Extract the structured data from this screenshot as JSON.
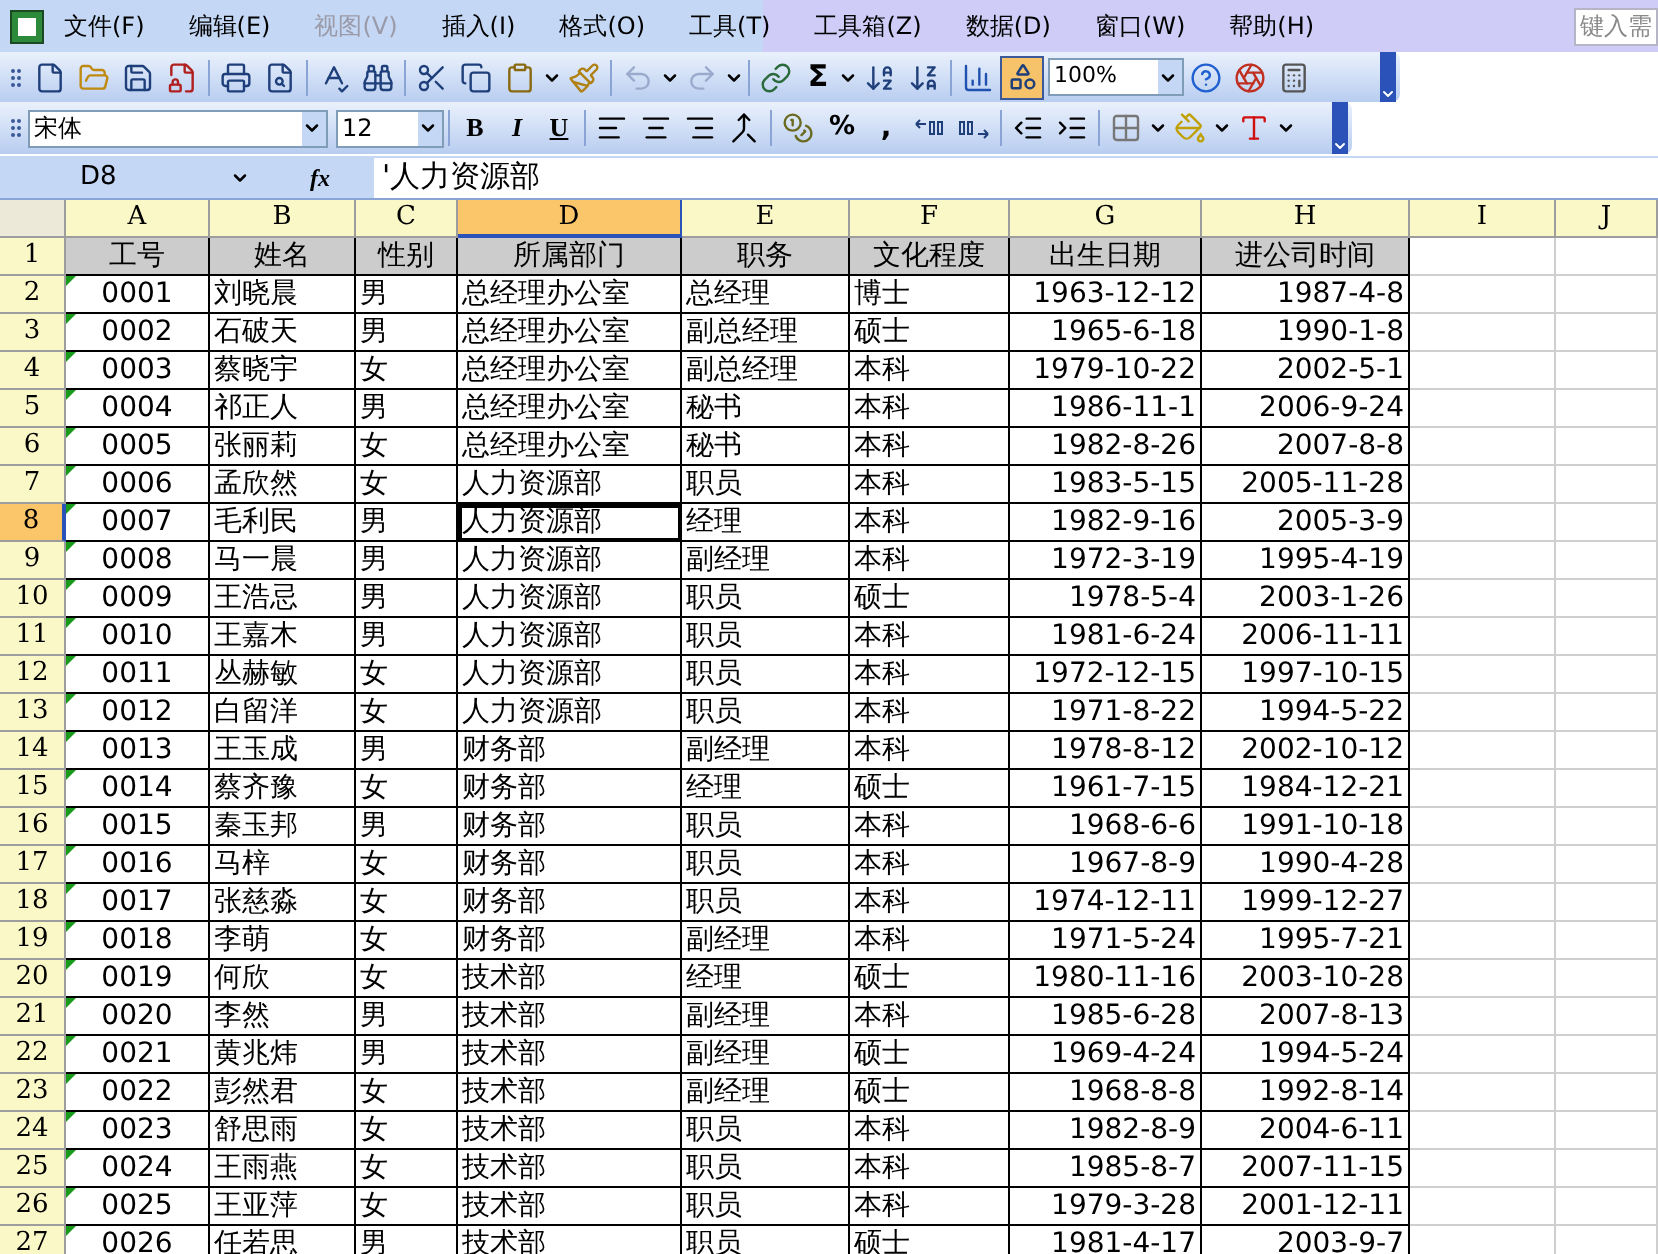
{
  "menu_bar": {
    "items": [
      {
        "label": "文件(F)",
        "disabled": false
      },
      {
        "label": "编辑(E)",
        "disabled": false
      },
      {
        "label": "视图(V)",
        "disabled": true
      },
      {
        "label": "插入(I)",
        "disabled": false
      },
      {
        "label": "格式(O)",
        "disabled": false
      },
      {
        "label": "工具(T)",
        "disabled": false
      },
      {
        "label": "工具箱(Z)",
        "disabled": false
      },
      {
        "label": "数据(D)",
        "disabled": false
      },
      {
        "label": "窗口(W)",
        "disabled": false
      },
      {
        "label": "帮助(H)",
        "disabled": false
      }
    ],
    "help_box": {
      "placeholder": "键入需"
    }
  },
  "standard_toolbar": {
    "sum_symbol": "Σ",
    "zoom": "100%"
  },
  "formatting_toolbar": {
    "font": "宋体",
    "font_size": "12",
    "style_buttons": [
      "B",
      "I",
      "U"
    ],
    "percent": "%",
    "comma": ","
  },
  "formula_bar": {
    "name_box": "D8",
    "fx": "fx",
    "value": "'人力资源部"
  },
  "sheet": {
    "columns": [
      {
        "label": "A",
        "selected": false
      },
      {
        "label": "B",
        "selected": false
      },
      {
        "label": "C",
        "selected": false
      },
      {
        "label": "D",
        "selected": true
      },
      {
        "label": "E",
        "selected": false
      },
      {
        "label": "F",
        "selected": false
      },
      {
        "label": "G",
        "selected": false
      },
      {
        "label": "H",
        "selected": false
      },
      {
        "label": "I",
        "selected": false
      },
      {
        "label": "J",
        "selected": false
      }
    ],
    "rows": [
      {
        "number": "1",
        "selected": false,
        "cells": [
          "工号",
          "姓名",
          "性别",
          "所属部门",
          "职务",
          "文化程度",
          "出生日期",
          "进公司时间"
        ]
      },
      {
        "number": "2",
        "selected": false,
        "cells": [
          "0001",
          "刘晓晨",
          "男",
          "总经理办公室",
          "总经理",
          "博士",
          "1963-12-12",
          "1987-4-8"
        ]
      },
      {
        "number": "3",
        "selected": false,
        "cells": [
          "0002",
          "石破天",
          "男",
          "总经理办公室",
          "副总经理",
          "硕士",
          "1965-6-18",
          "1990-1-8"
        ]
      },
      {
        "number": "4",
        "selected": false,
        "cells": [
          "0003",
          "蔡晓宇",
          "女",
          "总经理办公室",
          "副总经理",
          "本科",
          "1979-10-22",
          "2002-5-1"
        ]
      },
      {
        "number": "5",
        "selected": false,
        "cells": [
          "0004",
          "祁正人",
          "男",
          "总经理办公室",
          "秘书",
          "本科",
          "1986-11-1",
          "2006-9-24"
        ]
      },
      {
        "number": "6",
        "selected": false,
        "cells": [
          "0005",
          "张丽莉",
          "女",
          "总经理办公室",
          "秘书",
          "本科",
          "1982-8-26",
          "2007-8-8"
        ]
      },
      {
        "number": "7",
        "selected": false,
        "cells": [
          "0006",
          "孟欣然",
          "女",
          "人力资源部",
          "职员",
          "本科",
          "1983-5-15",
          "2005-11-28"
        ]
      },
      {
        "number": "8",
        "selected": true,
        "cells": [
          "0007",
          "毛利民",
          "男",
          "人力资源部",
          "经理",
          "本科",
          "1982-9-16",
          "2005-3-9"
        ]
      },
      {
        "number": "9",
        "selected": false,
        "cells": [
          "0008",
          "马一晨",
          "男",
          "人力资源部",
          "副经理",
          "本科",
          "1972-3-19",
          "1995-4-19"
        ]
      },
      {
        "number": "10",
        "selected": false,
        "cells": [
          "0009",
          "王浩忌",
          "男",
          "人力资源部",
          "职员",
          "硕士",
          "1978-5-4",
          "2003-1-26"
        ]
      },
      {
        "number": "11",
        "selected": false,
        "cells": [
          "0010",
          "王嘉木",
          "男",
          "人力资源部",
          "职员",
          "本科",
          "1981-6-24",
          "2006-11-11"
        ]
      },
      {
        "number": "12",
        "selected": false,
        "cells": [
          "0011",
          "丛赫敏",
          "女",
          "人力资源部",
          "职员",
          "本科",
          "1972-12-15",
          "1997-10-15"
        ]
      },
      {
        "number": "13",
        "selected": false,
        "cells": [
          "0012",
          "白留洋",
          "女",
          "人力资源部",
          "职员",
          "本科",
          "1971-8-22",
          "1994-5-22"
        ]
      },
      {
        "number": "14",
        "selected": false,
        "cells": [
          "0013",
          "王玉成",
          "男",
          "财务部",
          "副经理",
          "本科",
          "1978-8-12",
          "2002-10-12"
        ]
      },
      {
        "number": "15",
        "selected": false,
        "cells": [
          "0014",
          "蔡齐豫",
          "女",
          "财务部",
          "经理",
          "硕士",
          "1961-7-15",
          "1984-12-21"
        ]
      },
      {
        "number": "16",
        "selected": false,
        "cells": [
          "0015",
          "秦玉邦",
          "男",
          "财务部",
          "职员",
          "本科",
          "1968-6-6",
          "1991-10-18"
        ]
      },
      {
        "number": "17",
        "selected": false,
        "cells": [
          "0016",
          "马梓",
          "女",
          "财务部",
          "职员",
          "本科",
          "1967-8-9",
          "1990-4-28"
        ]
      },
      {
        "number": "18",
        "selected": false,
        "cells": [
          "0017",
          "张慈淼",
          "女",
          "财务部",
          "职员",
          "本科",
          "1974-12-11",
          "1999-12-27"
        ]
      },
      {
        "number": "19",
        "selected": false,
        "cells": [
          "0018",
          "李萌",
          "女",
          "财务部",
          "副经理",
          "本科",
          "1971-5-24",
          "1995-7-21"
        ]
      },
      {
        "number": "20",
        "selected": false,
        "cells": [
          "0019",
          "何欣",
          "女",
          "技术部",
          "经理",
          "硕士",
          "1980-11-16",
          "2003-10-28"
        ]
      },
      {
        "number": "21",
        "selected": false,
        "cells": [
          "0020",
          "李然",
          "男",
          "技术部",
          "副经理",
          "本科",
          "1985-6-28",
          "2007-8-13"
        ]
      },
      {
        "number": "22",
        "selected": false,
        "cells": [
          "0021",
          "黄兆炜",
          "男",
          "技术部",
          "副经理",
          "硕士",
          "1969-4-24",
          "1994-5-24"
        ]
      },
      {
        "number": "23",
        "selected": false,
        "cells": [
          "0022",
          "彭然君",
          "女",
          "技术部",
          "副经理",
          "硕士",
          "1968-8-8",
          "1992-8-14"
        ]
      },
      {
        "number": "24",
        "selected": false,
        "cells": [
          "0023",
          "舒思雨",
          "女",
          "技术部",
          "职员",
          "本科",
          "1982-8-9",
          "2004-6-11"
        ]
      },
      {
        "number": "25",
        "selected": false,
        "cells": [
          "0024",
          "王雨燕",
          "女",
          "技术部",
          "职员",
          "本科",
          "1985-8-7",
          "2007-11-15"
        ]
      },
      {
        "number": "26",
        "selected": false,
        "cells": [
          "0025",
          "王亚萍",
          "女",
          "技术部",
          "职员",
          "本科",
          "1979-3-28",
          "2001-12-11"
        ]
      },
      {
        "number": "27",
        "selected": false,
        "cells": [
          "0026",
          "任若思",
          "男",
          "技术部",
          "职员",
          "硕士",
          "1981-4-17",
          "2003-9-7"
        ]
      }
    ]
  }
}
